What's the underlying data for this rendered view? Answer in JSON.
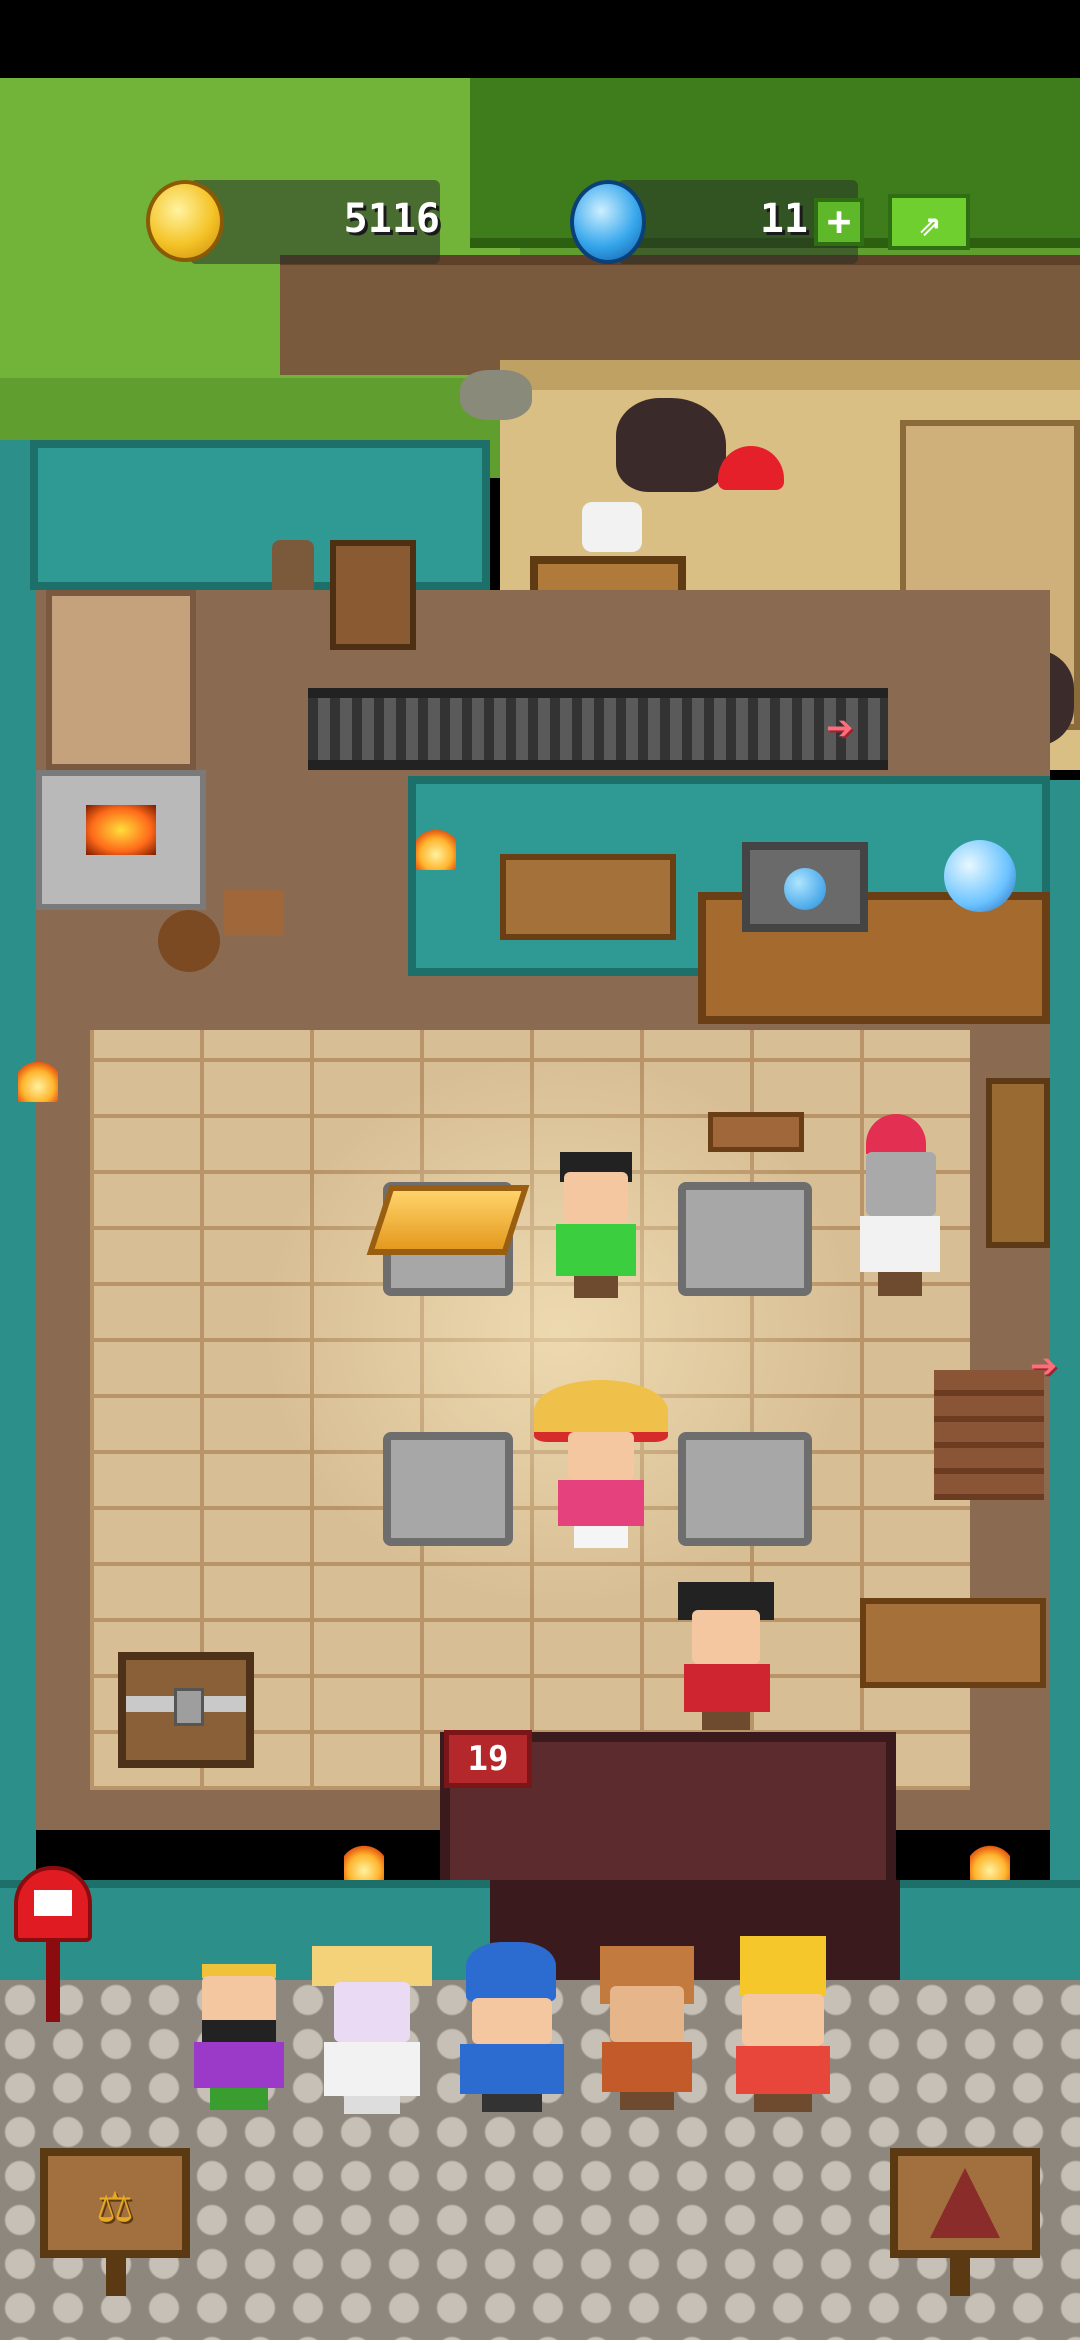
{
  "hud": {
    "coins": "5116",
    "gems": "11",
    "gem_plus_label": "+",
    "share_label": "⇗"
  },
  "counter": {
    "badge": "19"
  },
  "icons": {
    "coin": "coin-icon",
    "gem": "gem-icon",
    "mailbox": "mailbox-icon",
    "scale": "scale-icon",
    "castle": "castle-icon",
    "arrow_right": "arrow-right-icon"
  },
  "colors": {
    "grass": "#5f9e2f",
    "wall": "#2f9a93",
    "counter": "#5b2b2e",
    "badge": "#b4282c",
    "accent_green": "#6fcf2e"
  },
  "glyphs": {
    "arrow": "➔",
    "scale": "⚖"
  }
}
